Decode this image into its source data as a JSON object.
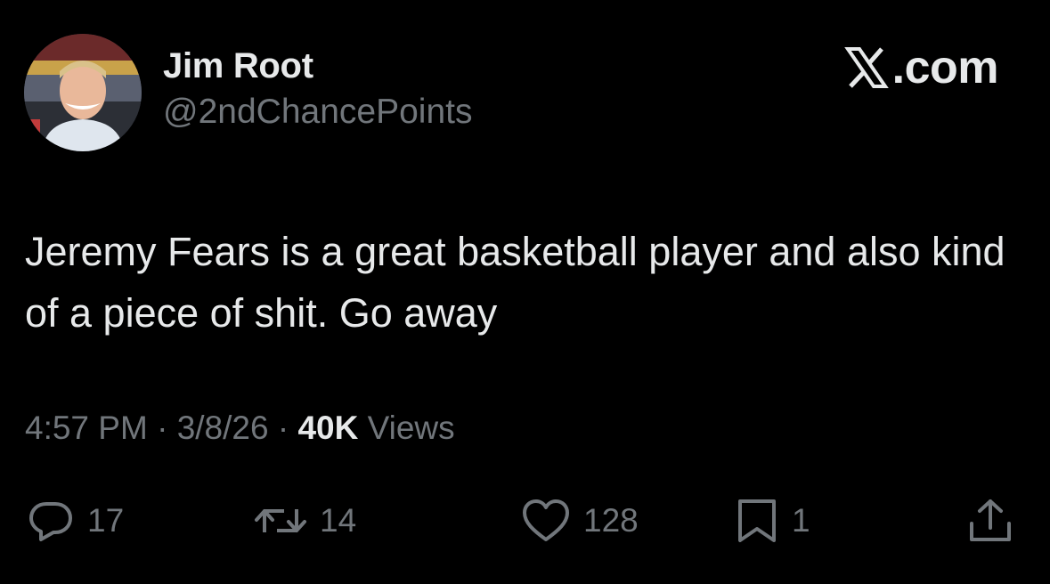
{
  "author": {
    "display_name": "Jim Root",
    "handle": "@2ndChancePoints"
  },
  "brand": {
    "label": ".com",
    "icon": "x-logo-icon"
  },
  "tweet": {
    "text": "Jeremy Fears is a great basketball player and also kind of a piece of shit. Go away"
  },
  "meta": {
    "time": "4:57 PM",
    "separator": " · ",
    "date": "3/8/26",
    "views_count": "40K",
    "views_label": " Views"
  },
  "actions": {
    "replies": "17",
    "reposts": "14",
    "likes": "128",
    "bookmarks": "1"
  },
  "icons": {
    "reply": "reply-bubble-icon",
    "repost": "repost-arrows-icon",
    "like": "heart-icon",
    "bookmark": "bookmark-icon",
    "share": "share-upload-icon"
  },
  "colors": {
    "background": "#000000",
    "primary_text": "#e7e9ea",
    "secondary_text": "#71767b"
  }
}
